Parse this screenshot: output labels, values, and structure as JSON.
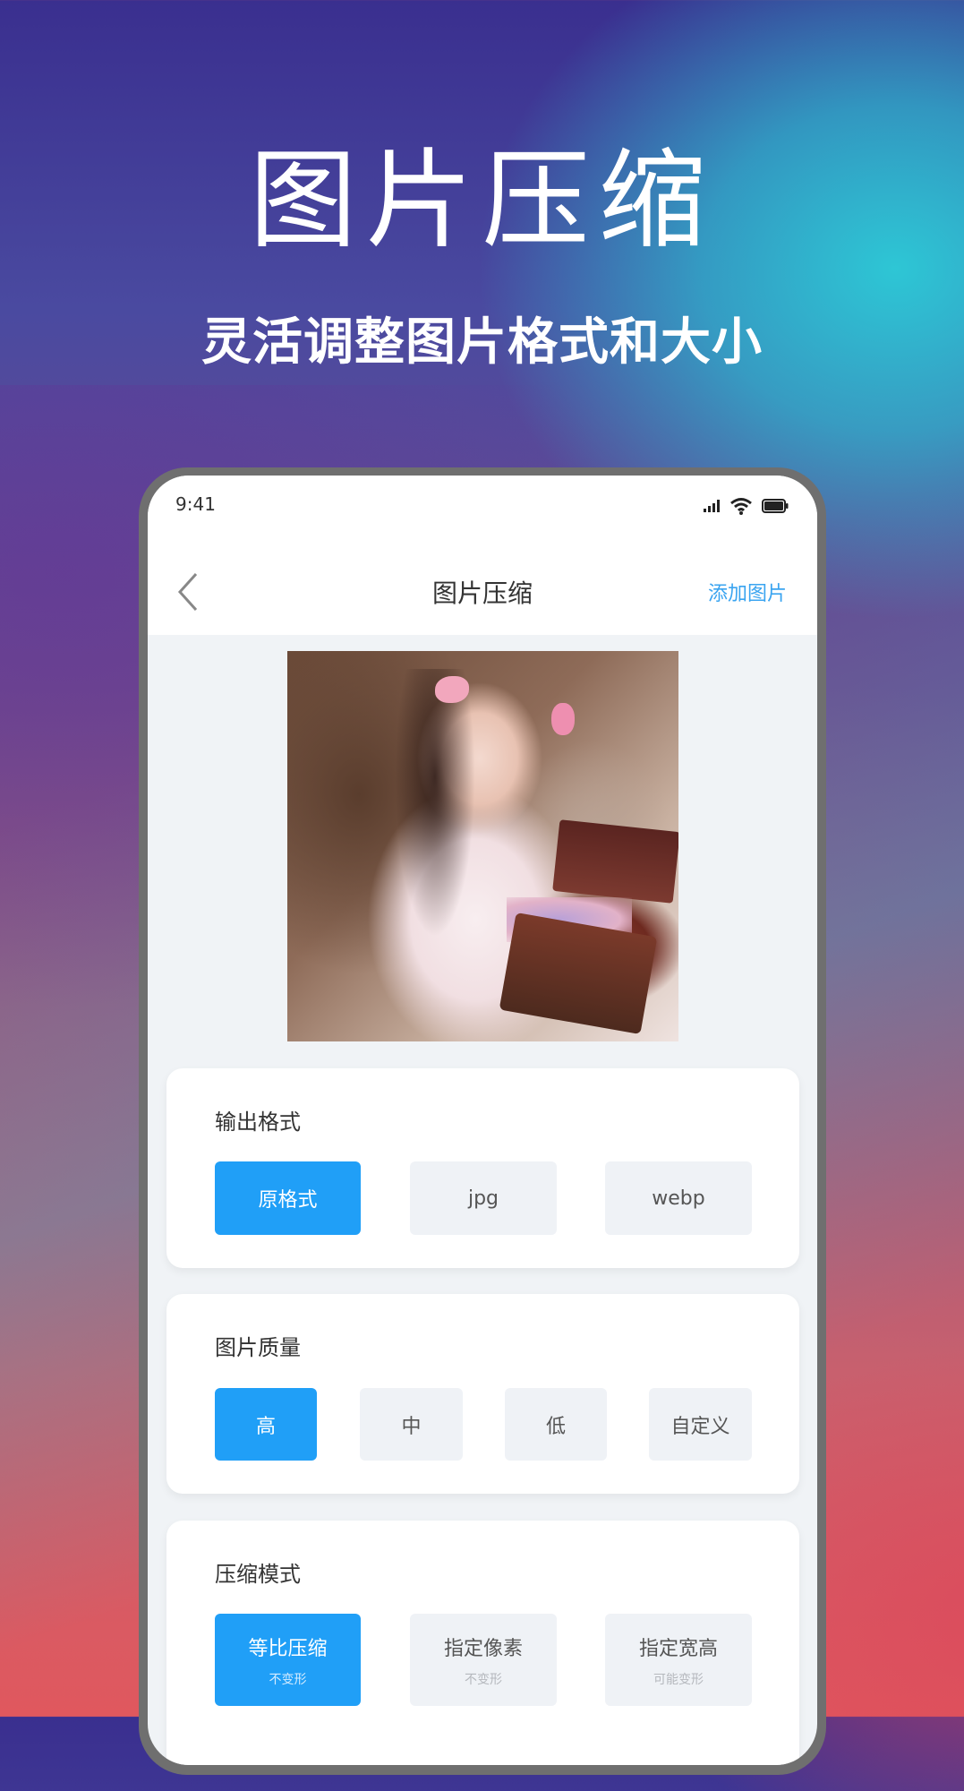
{
  "hero": {
    "title": "图片压缩",
    "subtitle": "灵活调整图片格式和大小"
  },
  "status_bar": {
    "time": "9:41",
    "icons": [
      "signal-icon",
      "wifi-icon",
      "battery-icon"
    ]
  },
  "nav": {
    "back_icon": "chevron-left-icon",
    "title": "图片压缩",
    "action": "添加图片"
  },
  "preview": {
    "alt": "preview photo"
  },
  "sections": [
    {
      "title": "输出格式",
      "options": [
        {
          "label": "原格式",
          "selected": true
        },
        {
          "label": "jpg",
          "selected": false
        },
        {
          "label": "webp",
          "selected": false
        }
      ]
    },
    {
      "title": "图片质量",
      "options": [
        {
          "label": "高",
          "selected": true
        },
        {
          "label": "中",
          "selected": false
        },
        {
          "label": "低",
          "selected": false
        },
        {
          "label": "自定义",
          "selected": false
        }
      ]
    },
    {
      "title": "压缩模式",
      "options": [
        {
          "label": "等比压缩",
          "sub": "不变形",
          "selected": true
        },
        {
          "label": "指定像素",
          "sub": "不变形",
          "selected": false
        },
        {
          "label": "指定宽高",
          "sub": "可能变形",
          "selected": false
        }
      ]
    }
  ],
  "colors": {
    "accent": "#209ff7",
    "link": "#3aa4f0",
    "option_bg": "#eff2f6",
    "page_bg": "#f0f3f6"
  }
}
